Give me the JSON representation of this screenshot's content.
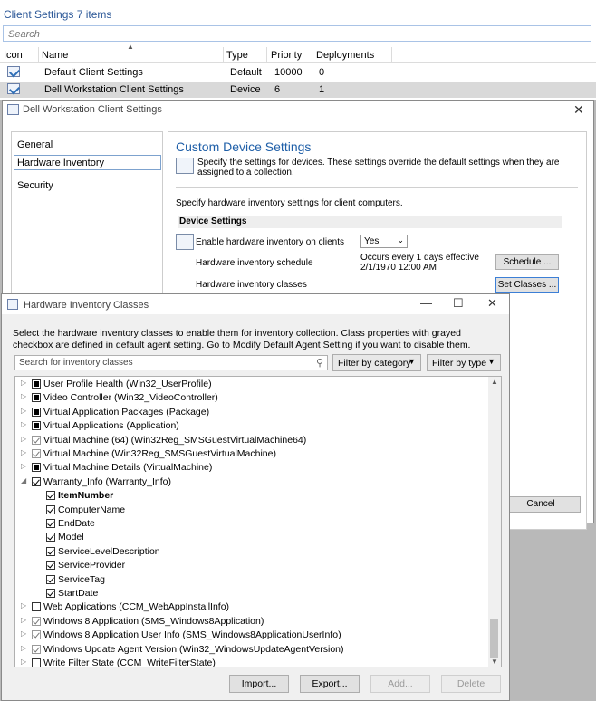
{
  "client_settings": {
    "title": "Client Settings",
    "count": "7 items",
    "search_placeholder": "Search",
    "columns": [
      "Icon",
      "Name",
      "Type",
      "Priority",
      "Deployments"
    ],
    "rows": [
      {
        "name": "Default Client Settings",
        "type": "Default",
        "priority": "10000",
        "deployments": "0"
      },
      {
        "name": "Dell Workstation Client Settings",
        "type": "Device",
        "priority": "6",
        "deployments": "1"
      }
    ]
  },
  "dell_dialog": {
    "title": "Dell Workstation Client Settings",
    "close": "✕",
    "nav": [
      "General",
      "Hardware Inventory",
      "Security"
    ],
    "content_title": "Custom Device Settings",
    "content_desc": "Specify the settings for devices. These settings override the default settings when they are assigned to a collection.",
    "content_sub": "Specify hardware inventory settings for client computers.",
    "device_settings_label": "Device Settings",
    "enable_label": "Enable hardware inventory on clients",
    "enable_value": "Yes",
    "schedule_label": "Hardware inventory schedule",
    "schedule_value_1": "Occurs every 1 days effective",
    "schedule_value_2": "2/1/1970 12:00 AM",
    "schedule_button": "Schedule ...",
    "classes_label": "Hardware inventory classes",
    "classes_button": "Set Classes ...",
    "cancel_button": "Cancel"
  },
  "hic_dialog": {
    "title": "Hardware Inventory Classes",
    "minimize": "—",
    "maximize": "☐",
    "close": "✕",
    "description": "Select the hardware inventory classes to enable them for inventory collection. Class properties with grayed checkbox are defined in default agent setting. Go to Modify Default Agent Setting if you want to disable them.",
    "search_placeholder": "Search for inventory classes",
    "filter_category": "Filter by category",
    "filter_type": "Filter by type",
    "tree": [
      {
        "label": "User Profile Health (Win32_UserProfile)",
        "state": "fill",
        "expanded": false,
        "level": 0
      },
      {
        "label": "Video Controller (Win32_VideoController)",
        "state": "fill",
        "expanded": false,
        "level": 0
      },
      {
        "label": "Virtual Application Packages (Package)",
        "state": "fill",
        "expanded": false,
        "level": 0
      },
      {
        "label": "Virtual Applications (Application)",
        "state": "fill",
        "expanded": false,
        "level": 0
      },
      {
        "label": "Virtual Machine (64) (Win32Reg_SMSGuestVirtualMachine64)",
        "state": "graycheck",
        "expanded": false,
        "level": 0
      },
      {
        "label": "Virtual Machine (Win32Reg_SMSGuestVirtualMachine)",
        "state": "graycheck",
        "expanded": false,
        "level": 0
      },
      {
        "label": "Virtual Machine Details (VirtualMachine)",
        "state": "fill",
        "expanded": false,
        "level": 0
      },
      {
        "label": "Warranty_Info (Warranty_Info)",
        "state": "check",
        "expanded": true,
        "level": 0
      },
      {
        "label": "ItemNumber",
        "state": "check",
        "level": 1,
        "bold": true
      },
      {
        "label": "ComputerName",
        "state": "check",
        "level": 1
      },
      {
        "label": "EndDate",
        "state": "check",
        "level": 1
      },
      {
        "label": "Model",
        "state": "check",
        "level": 1
      },
      {
        "label": "ServiceLevelDescription",
        "state": "check",
        "level": 1
      },
      {
        "label": "ServiceProvider",
        "state": "check",
        "level": 1
      },
      {
        "label": "ServiceTag",
        "state": "check",
        "level": 1
      },
      {
        "label": "StartDate",
        "state": "check",
        "level": 1
      },
      {
        "label": "Web Applications (CCM_WebAppInstallInfo)",
        "state": "empty",
        "expanded": false,
        "level": 0
      },
      {
        "label": "Windows 8 Application (SMS_Windows8Application)",
        "state": "graycheck",
        "expanded": false,
        "level": 0
      },
      {
        "label": "Windows 8 Application User Info (SMS_Windows8ApplicationUserInfo)",
        "state": "graycheck",
        "expanded": false,
        "level": 0
      },
      {
        "label": "Windows Update Agent Version (Win32_WindowsUpdateAgentVersion)",
        "state": "graycheck",
        "expanded": false,
        "level": 0
      },
      {
        "label": "Write Filter State (CCM_WriteFilterState)",
        "state": "empty",
        "expanded": false,
        "level": 0
      }
    ],
    "buttons": {
      "import": "Import...",
      "export": "Export...",
      "add": "Add...",
      "delete": "Delete"
    }
  }
}
